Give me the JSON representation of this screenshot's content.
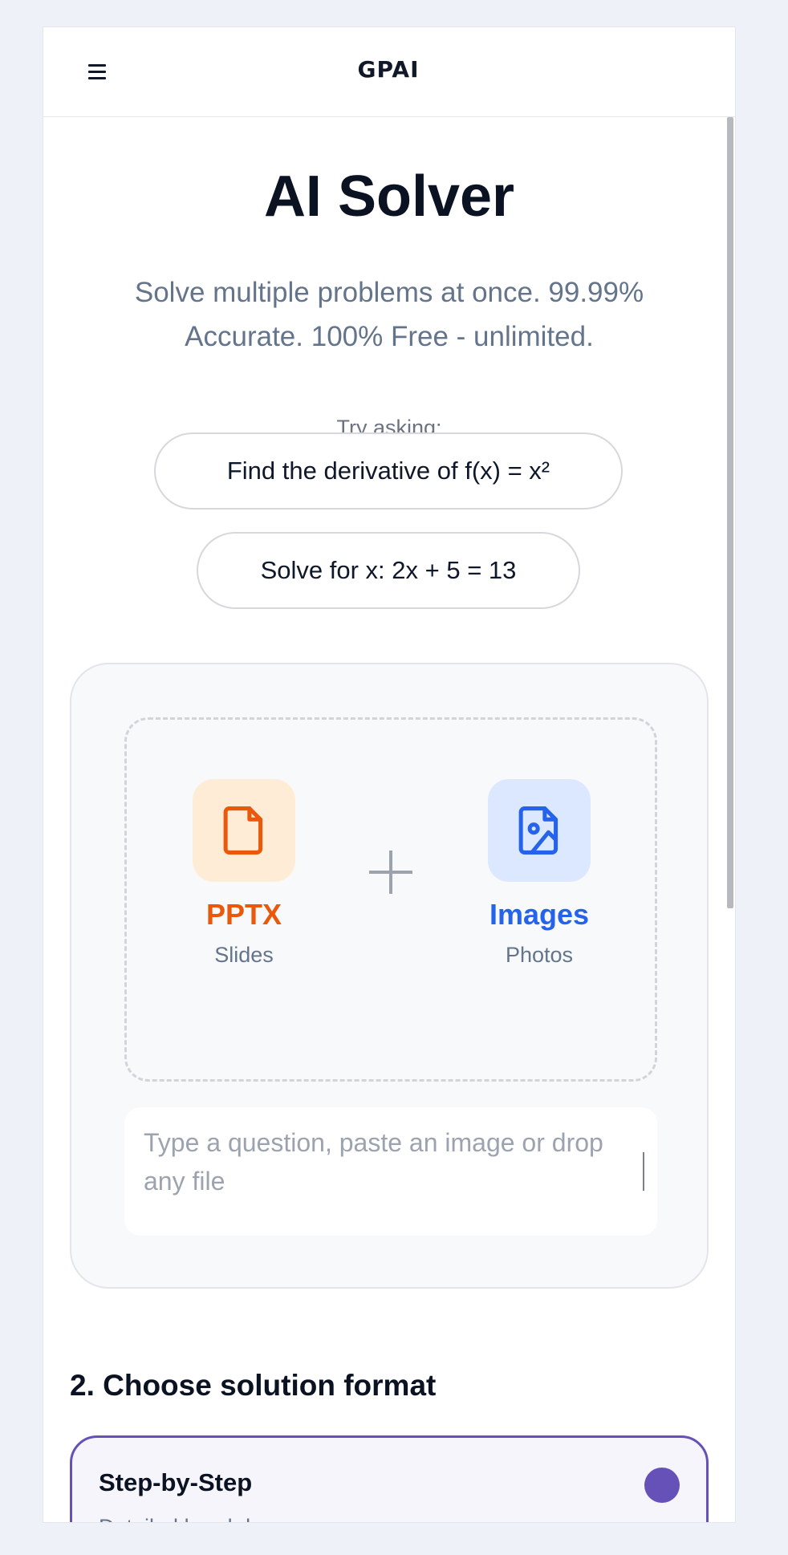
{
  "header": {
    "logo_text": "GPAI",
    "menu_icon": "hamburger-menu-icon"
  },
  "hero": {
    "title": "AI Solver",
    "subtitle": "Solve multiple problems at once. 99.99% Accurate. 100% Free - unlimited."
  },
  "suggestions": {
    "label": "Try asking:",
    "items": [
      "Find the derivative of f(x) = x²",
      "Solve for x: 2x + 5 = 13"
    ]
  },
  "upload": {
    "pptx": {
      "title": "PPTX",
      "subtitle": "Slides",
      "icon": "file-icon",
      "color": "#ea580c",
      "tile_color": "#ffecd6"
    },
    "plus_icon": "plus-icon",
    "images": {
      "title": "Images",
      "subtitle": "Photos",
      "icon": "image-file-icon",
      "color": "#2563eb",
      "tile_color": "#dbe8ff"
    },
    "question_placeholder": "Type a question, paste an image or drop any file"
  },
  "format": {
    "heading": "2. Choose solution format",
    "options": [
      {
        "title": "Step-by-Step",
        "subtitle": "Detailed breakdown",
        "selected": true
      }
    ],
    "accent_color": "#6651b9"
  }
}
